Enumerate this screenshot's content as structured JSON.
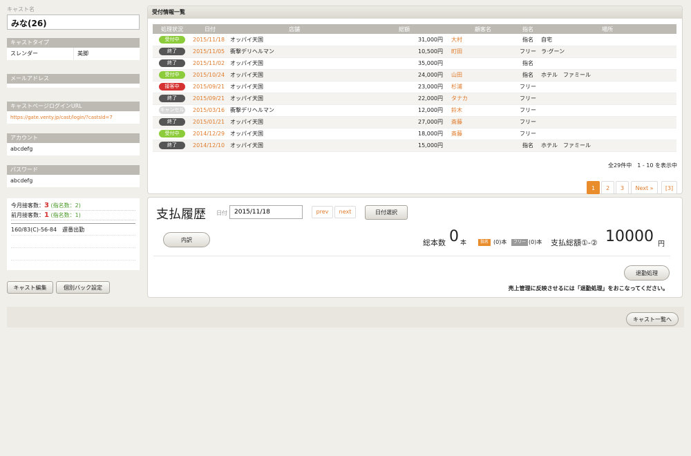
{
  "cast": {
    "name_label": "キャスト名",
    "name": "みな(26)",
    "type_label": "キャストタイプ",
    "types": [
      "スレンダー",
      "美脚"
    ],
    "email_label": "メールアドレス",
    "email": "",
    "login_url_label": "キャストページログインURL",
    "login_url": "https://gate.venty.jp/cast/login/?castsId=7",
    "account_label": "アカウント",
    "account": "abcdefg",
    "password_label": "パスワード",
    "password": "abcdefg"
  },
  "stats": {
    "this_month_label": "今月接客数：",
    "this_month_count": "3",
    "this_month_nominated": "(指名数：2)",
    "last_month_label": "前月接客数：",
    "last_month_count": "1",
    "last_month_nominated": "(指名数：1)",
    "notes": [
      "160/83(C)-56-84　遅番出勤",
      "",
      "",
      ""
    ]
  },
  "buttons": {
    "edit_cast": "キャスト編集",
    "individual_back": "個別バック設定",
    "breakdown": "内訳",
    "date_select": "日付選択",
    "close_process": "退勤処理",
    "back_to_list": "キャスト一覧へ"
  },
  "records": {
    "title": "受付情報一覧",
    "headers": [
      "処理状況",
      "日付",
      "店舗",
      "総額",
      "顧客名",
      "指名",
      "場所"
    ],
    "rows": [
      {
        "status": "受付中",
        "status_color": "green",
        "date": "2015/11/18",
        "shop": "オッパイ天国",
        "total": "31,000円",
        "customer": "大村",
        "nomination": "指名",
        "place": "自宅"
      },
      {
        "status": "終了",
        "status_color": "dark",
        "date": "2015/11/05",
        "shop": "衝撃デリヘルマン",
        "total": "10,500円",
        "customer": "町田",
        "nomination": "フリー",
        "place": "ラ·グーン"
      },
      {
        "status": "終了",
        "status_color": "dark",
        "date": "2015/11/02",
        "shop": "オッパイ天国",
        "total": "35,000円",
        "customer": "",
        "nomination": "指名",
        "place": ""
      },
      {
        "status": "受付中",
        "status_color": "green",
        "date": "2015/10/24",
        "shop": "オッパイ天国",
        "total": "24,000円",
        "customer": "山田",
        "nomination": "指名",
        "place": "ホテル　ファミール"
      },
      {
        "status": "接客中",
        "status_color": "red",
        "date": "2015/09/21",
        "shop": "オッパイ天国",
        "total": "23,000円",
        "customer": "杉浦",
        "nomination": "フリー",
        "place": ""
      },
      {
        "status": "終了",
        "status_color": "dark",
        "date": "2015/09/21",
        "shop": "オッパイ天国",
        "total": "22,000円",
        "customer": "タナカ",
        "nomination": "フリー",
        "place": ""
      },
      {
        "status": "キャンセル",
        "status_color": "gray",
        "date": "2015/03/16",
        "shop": "衝撃デリヘルマン",
        "total": "12,000円",
        "customer": "鈴木",
        "nomination": "フリー",
        "place": ""
      },
      {
        "status": "終了",
        "status_color": "dark",
        "date": "2015/01/21",
        "shop": "オッパイ天国",
        "total": "27,000円",
        "customer": "斎藤",
        "nomination": "フリー",
        "place": ""
      },
      {
        "status": "受付中",
        "status_color": "green",
        "date": "2014/12/29",
        "shop": "オッパイ天国",
        "total": "18,000円",
        "customer": "斎藤",
        "nomination": "フリー",
        "place": ""
      },
      {
        "status": "終了",
        "status_color": "dark",
        "date": "2014/12/10",
        "shop": "オッパイ天国",
        "total": "15,000円",
        "customer": "",
        "nomination": "指名",
        "place": "ホテル　ファミール"
      }
    ],
    "summary": "全29件中　1 - 10 を表示中",
    "pages": [
      "1",
      "2",
      "3",
      "Next »",
      "[3]"
    ],
    "active_page": "1"
  },
  "payment": {
    "title": "支払履歴",
    "date_label": "日付",
    "date_value": "2015/11/18",
    "prev_label": "prev",
    "next_label": "next",
    "total_count_label": "総本数",
    "total_count_value": "0",
    "unit": "本",
    "nominated_tag": "指名",
    "nominated_count": "(0)本",
    "free_tag": "フリー",
    "free_count": "(0)本",
    "total_amount_label": "支払総額①-②",
    "total_amount_value": "10000",
    "currency": "円",
    "notice": "売上管理に反映させるには「退勤処理」をおこなってください。"
  },
  "colors": {
    "accent": "#e07a2a",
    "status_green": "#8ccc3a",
    "status_dark": "#555555",
    "status_red": "#d63131",
    "status_gray": "#d7d7d7"
  }
}
